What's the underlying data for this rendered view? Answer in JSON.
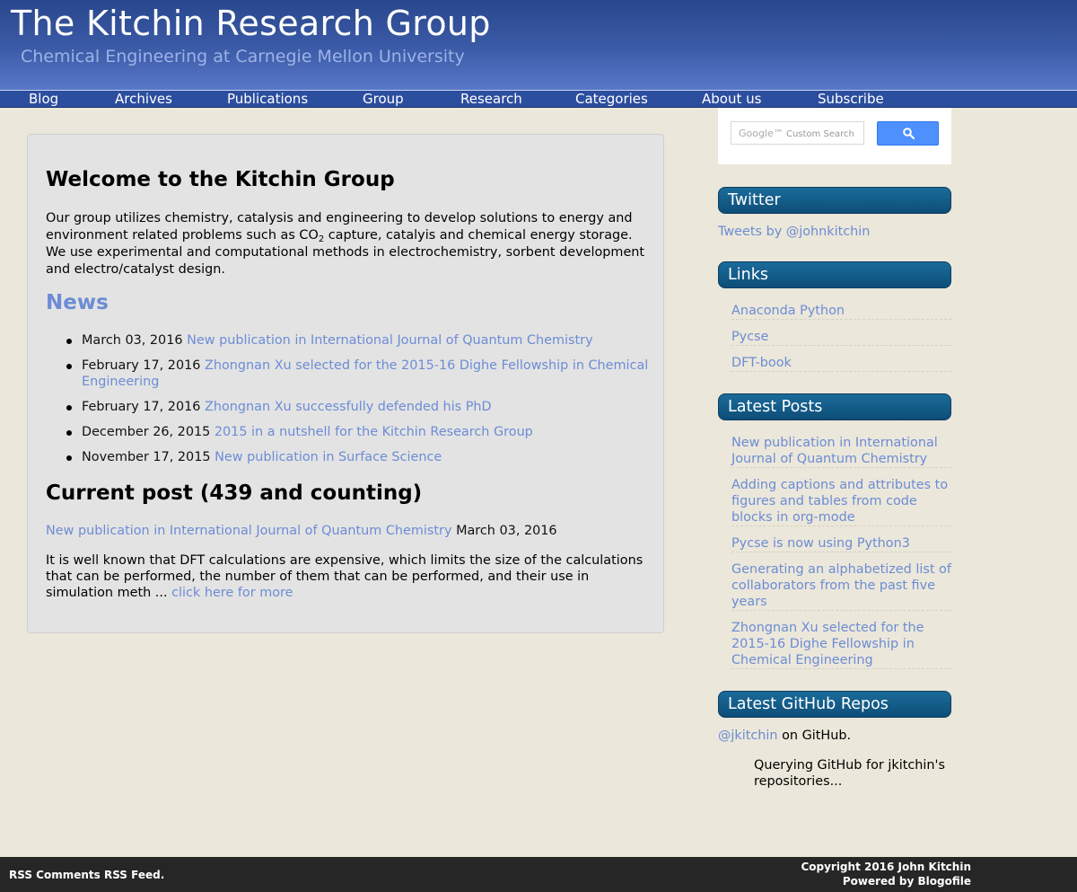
{
  "header": {
    "title": "The Kitchin Research Group",
    "subtitle": "Chemical Engineering at Carnegie Mellon University"
  },
  "nav": [
    "Blog",
    "Archives",
    "Publications",
    "Group",
    "Research",
    "Categories",
    "About us",
    "Subscribe"
  ],
  "main": {
    "welcome_title": "Welcome to the Kitchin Group",
    "intro_before_sub": "Our group utilizes chemistry, catalysis and engineering to develop solutions to energy and environment related problems such as CO",
    "intro_sub": "2",
    "intro_after_sub": " capture, catalyis and chemical energy storage. We use experimental and computational methods in electrochemistry, sorbent development and electro/catalyst design.",
    "news_title": "News",
    "news": [
      {
        "date": "March 03, 2016",
        "link": "New publication in International Journal of Quantum Chemistry"
      },
      {
        "date": "February 17, 2016",
        "link": "Zhongnan Xu selected for the 2015-16 Dighe Fellowship in Chemical Engineering"
      },
      {
        "date": "February 17, 2016",
        "link": "Zhongnan Xu successfully defended his PhD"
      },
      {
        "date": "December 26, 2015",
        "link": "2015 in a nutshell for the Kitchin Research Group"
      },
      {
        "date": "November 17, 2015",
        "link": "New publication in Surface Science"
      }
    ],
    "current_title": "Current post (439 and counting)",
    "current_post_link": "New publication in International Journal of Quantum Chemistry",
    "current_post_date": "March 03, 2016",
    "excerpt": "It is well known that DFT calculations are expensive, which limits the size of the calculations that can be performed, the number of them that can be performed, and their use in simulation meth ...",
    "more_link": "click here for more"
  },
  "sidebar": {
    "search_placeholder": "Custom Search",
    "search_brand": "Google™",
    "twitter_title": "Twitter",
    "twitter_link": "Tweets by @johnkitchin",
    "links_title": "Links",
    "links": [
      "Anaconda Python",
      "Pycse",
      "DFT-book"
    ],
    "latest_posts_title": "Latest Posts",
    "latest_posts": [
      "New publication in International Journal of Quantum Chemistry",
      "Adding captions and attributes to figures and tables from code blocks in org-mode",
      "Pycse is now using Python3",
      "Generating an alphabetized list of collaborators from the past five years",
      "Zhongnan Xu selected for the 2015-16 Dighe Fellowship in Chemical Engineering"
    ],
    "github_title": "Latest GitHub Repos",
    "github_user": "@jkitchin",
    "github_suffix": " on GitHub.",
    "github_status": "Querying GitHub for jkitchin's repositories..."
  },
  "footer": {
    "left": "RSS Comments RSS Feed.",
    "copyright": "Copyright 2016 John Kitchin",
    "powered": "Powered by Blogofile"
  },
  "colors": {
    "link": "#6c8cd5",
    "header": "#3c5ba8",
    "widget": "#0d4e78",
    "background": "#ebe7da"
  }
}
